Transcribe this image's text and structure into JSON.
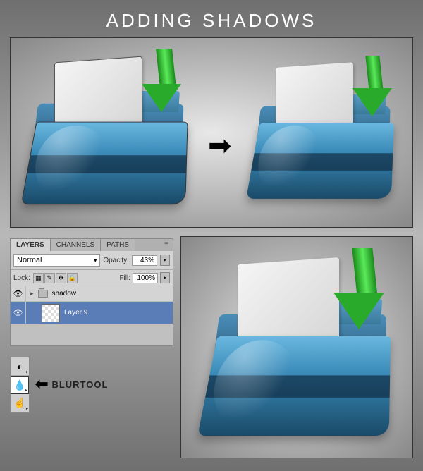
{
  "title": "ADDING SHADOWS",
  "layers_panel": {
    "tabs": {
      "layers": "LAYERS",
      "channels": "CHANNELS",
      "paths": "PATHS"
    },
    "blend_mode": "Normal",
    "opacity_label": "Opacity:",
    "opacity_value": "43%",
    "lock_label": "Lock:",
    "fill_label": "Fill:",
    "fill_value": "100%",
    "group_name": "shadow",
    "layer_name": "Layer 9"
  },
  "tools": {
    "blur_label": "BLURTOOL"
  },
  "icons": {
    "eye": "👁",
    "transition_arrow": "➡",
    "pointer_arrow": "⬅",
    "panel_menu": "≡",
    "dropdown": "▾",
    "expand": "▸",
    "triangle": "▸"
  }
}
